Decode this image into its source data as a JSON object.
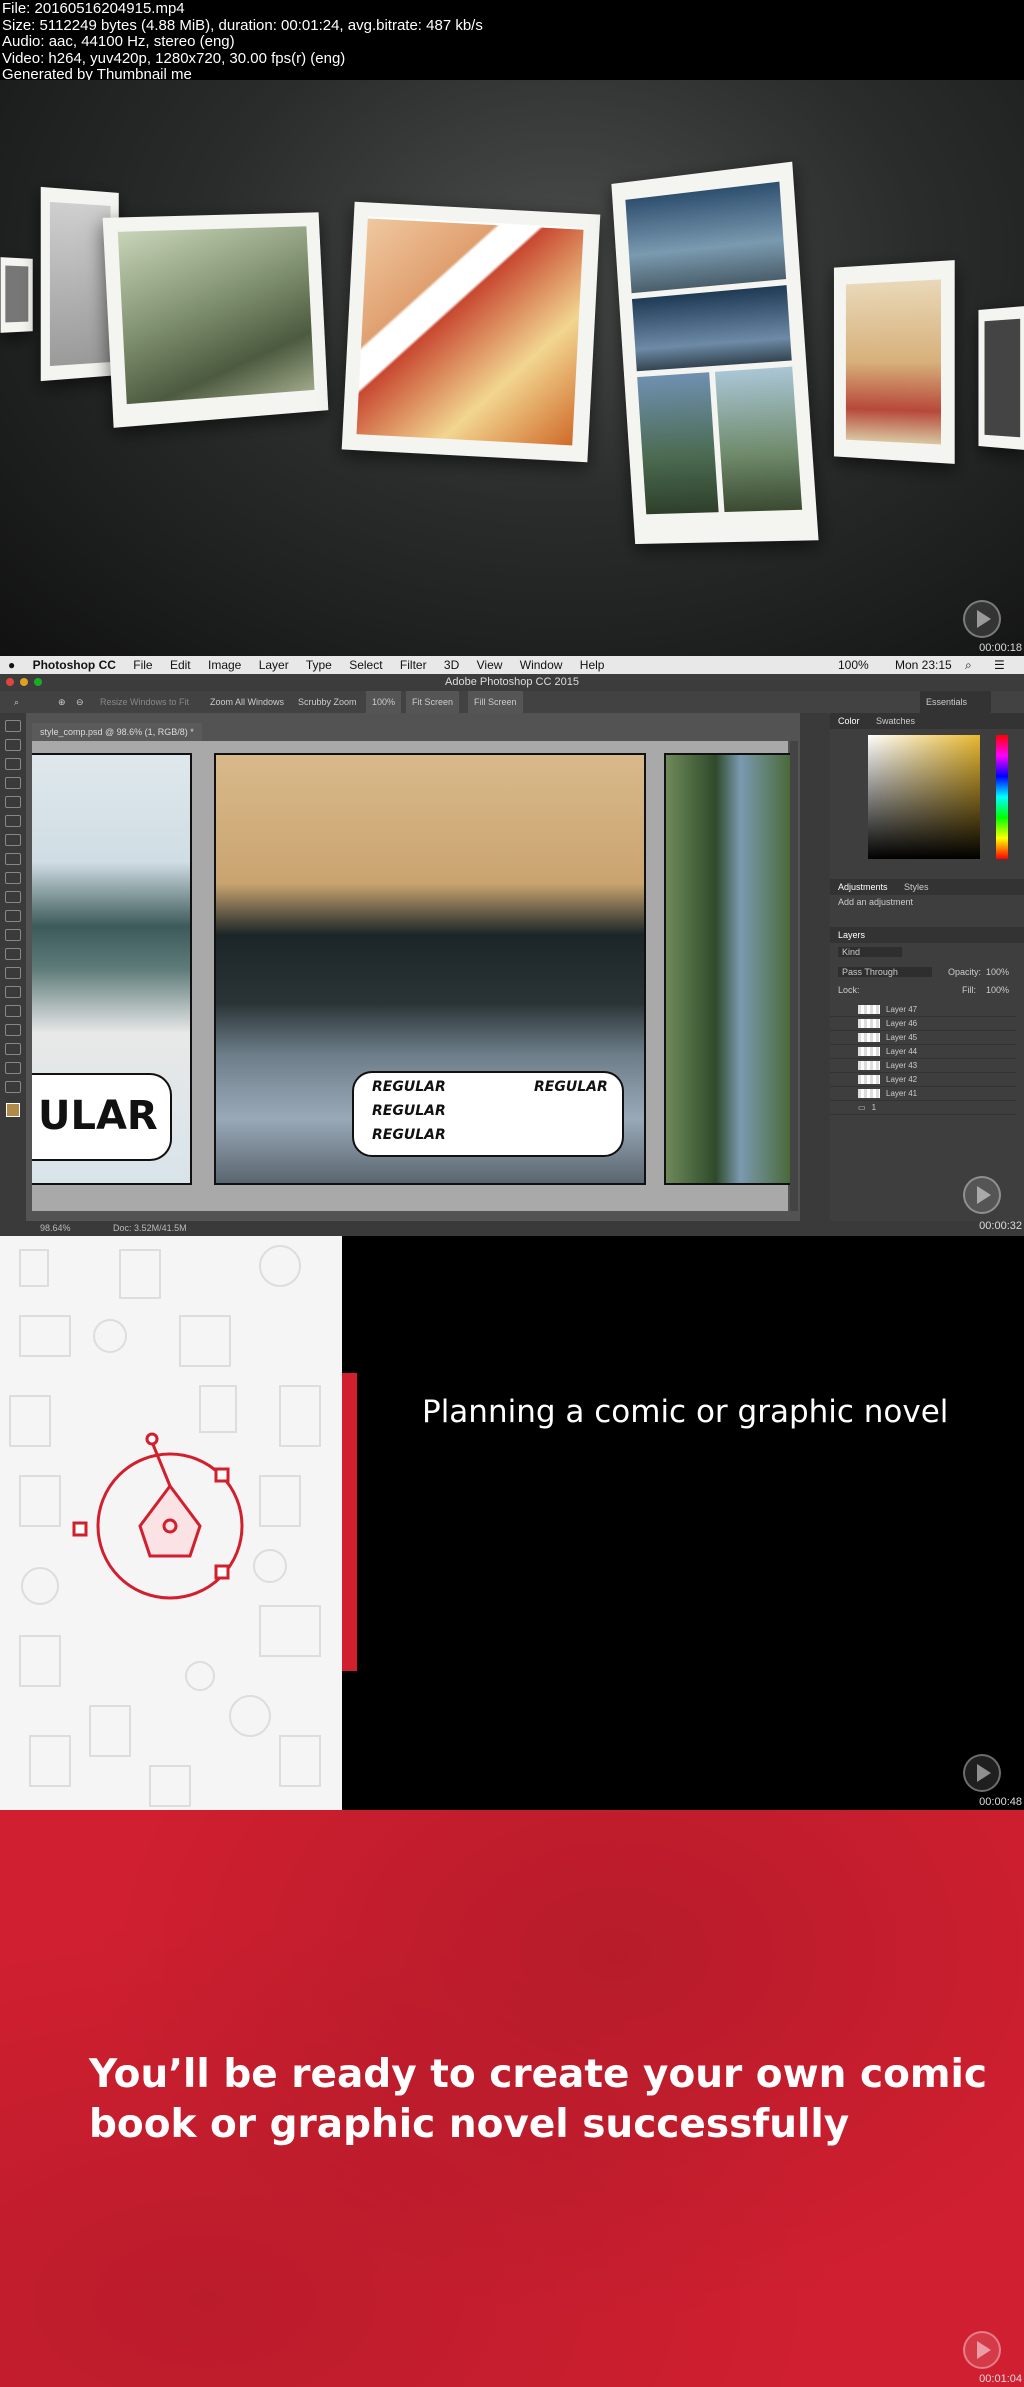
{
  "header": {
    "file": "File: 20160516204915.mp4",
    "size": "Size: 5112249 bytes (4.88 MiB), duration: 00:01:24, avg.bitrate: 487 kb/s",
    "audio": "Audio: aac, 44100 Hz, stereo (eng)",
    "video": "Video: h264, yuv420p, 1280x720, 30.00 fps(r) (eng)",
    "generated": "Generated by Thumbnail me"
  },
  "frames": [
    {
      "timestamp": "00:00:18"
    },
    {
      "timestamp": "00:00:32"
    },
    {
      "timestamp": "00:00:48"
    },
    {
      "timestamp": "00:01:04"
    }
  ],
  "photoshop": {
    "app_name": "Photoshop CC",
    "menu": [
      "File",
      "Edit",
      "Image",
      "Layer",
      "Type",
      "Select",
      "Filter",
      "3D",
      "View",
      "Window",
      "Help"
    ],
    "clock": "Mon 23:15",
    "battery": "100%",
    "window_title": "Adobe Photoshop CC 2015",
    "options": {
      "resize_windows": "Resize Windows to Fit",
      "zoom_all": "Zoom All Windows",
      "scrubby": "Scrubby Zoom",
      "zoom": "100%",
      "fit_screen": "Fit Screen",
      "fill_screen": "Fill Screen",
      "workspace": "Essentials"
    },
    "doc_tab": "style_comp.psd @ 98.6% (1, RGB/8) *",
    "canvas": {
      "left_bubble": "ULAR",
      "mid_bubble": [
        "REGULAR",
        "REGULAR",
        "REGULAR",
        "REGULAR"
      ]
    },
    "panels": {
      "color_tab": "Color",
      "swatches_tab": "Swatches",
      "adjustments_tab": "Adjustments",
      "styles_tab": "Styles",
      "add_adjustment": "Add an adjustment",
      "layers_tab": "Layers",
      "kind": "Kind",
      "blend_mode": "Pass Through",
      "opacity_label": "Opacity:",
      "opacity": "100%",
      "lock_label": "Lock:",
      "fill_label": "Fill:",
      "fill": "100%",
      "layers": [
        "Layer 47",
        "Layer 46",
        "Layer 45",
        "Layer 44",
        "Layer 43",
        "Layer 42",
        "Layer 41",
        "1"
      ]
    },
    "status": {
      "zoom": "98.64%",
      "doc": "Doc: 3.52M/41.5M"
    }
  },
  "slide3": {
    "title": "Planning a comic or graphic novel"
  },
  "slide4": {
    "line1": "You’ll be ready to create your own comic",
    "line2": "book or graphic novel successfully"
  },
  "colors": {
    "accent": "#d21f2e",
    "ps_bg": "#535353"
  }
}
